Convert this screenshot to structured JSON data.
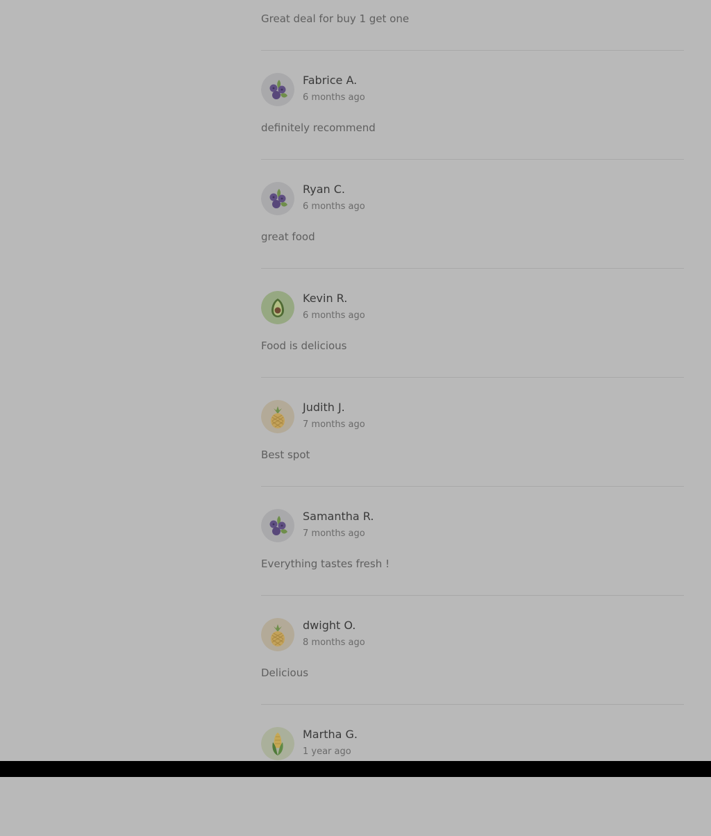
{
  "first_comment": "Great deal for buy 1 get one",
  "reviews": [
    {
      "name": "Fabrice A.",
      "time": "6 months ago",
      "text": "definitely recommend",
      "avatar_icon": "blueberry-icon"
    },
    {
      "name": "Ryan C.",
      "time": "6 months ago",
      "text": "great food",
      "avatar_icon": "blueberry-icon"
    },
    {
      "name": "Kevin R.",
      "time": "6 months ago",
      "text": "Food is delicious",
      "avatar_icon": "avocado-icon"
    },
    {
      "name": "Judith J.",
      "time": "7 months ago",
      "text": "Best spot",
      "avatar_icon": "pineapple-icon"
    },
    {
      "name": "Samantha R.",
      "time": "7 months ago",
      "text": "Everything tastes fresh !",
      "avatar_icon": "blueberry-icon"
    },
    {
      "name": "dwight O.",
      "time": "8 months ago",
      "text": "Delicious",
      "avatar_icon": "pineapple-icon"
    },
    {
      "name": "Martha G.",
      "time": "1 year ago",
      "text": "",
      "avatar_icon": "corn-icon"
    }
  ],
  "colors": {
    "overlay_background": "#b9b9b9",
    "name_text": "#3a3a3a",
    "body_text": "#5f5f5f",
    "divider": "#a8a8a8"
  }
}
